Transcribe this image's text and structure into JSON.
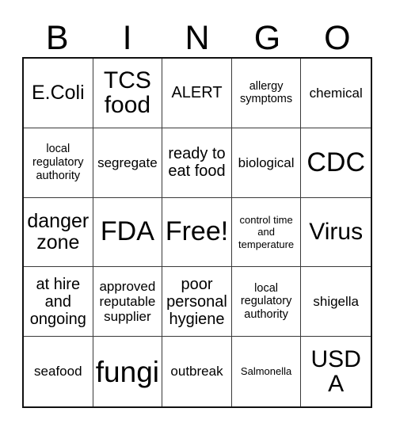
{
  "card": {
    "title": "BINGO",
    "header_letters": [
      "B",
      "I",
      "N",
      "G",
      "O"
    ],
    "free_space_label": "Free!",
    "colors": {
      "text": "#000000",
      "outer_border": "#111111",
      "inner_border": "#3a3a3a",
      "background": "#ffffff"
    },
    "rows": [
      [
        {
          "text": "E.Coli",
          "size": "fs-xl"
        },
        {
          "text": "TCS food",
          "size": "fs-2xl"
        },
        {
          "text": "ALERT",
          "size": "fs-lg"
        },
        {
          "text": "allergy symptoms",
          "size": "fs-sm"
        },
        {
          "text": "chemical",
          "size": "fs-md"
        }
      ],
      [
        {
          "text": "local regulatory authority",
          "size": "fs-sm"
        },
        {
          "text": "segregate",
          "size": "fs-md"
        },
        {
          "text": "ready to eat food",
          "size": "fs-lg"
        },
        {
          "text": "biological",
          "size": "fs-md"
        },
        {
          "text": "CDC",
          "size": "fs-3xl"
        }
      ],
      [
        {
          "text": "danger zone",
          "size": "fs-xl"
        },
        {
          "text": "FDA",
          "size": "fs-3xl"
        },
        {
          "text": "Free!",
          "size": "fs-3xl"
        },
        {
          "text": "control time and temperature",
          "size": "fs-xs"
        },
        {
          "text": "Virus",
          "size": "fs-2xl"
        }
      ],
      [
        {
          "text": "at hire and ongoing",
          "size": "fs-lg"
        },
        {
          "text": "approved reputable supplier",
          "size": "fs-md"
        },
        {
          "text": "poor personal hygiene",
          "size": "fs-lg"
        },
        {
          "text": "local regulatory authority",
          "size": "fs-sm"
        },
        {
          "text": "shigella",
          "size": "fs-md"
        }
      ],
      [
        {
          "text": "seafood",
          "size": "fs-md"
        },
        {
          "text": "fungi",
          "size": "fs-4xl"
        },
        {
          "text": "outbreak",
          "size": "fs-md"
        },
        {
          "text": "Salmonella",
          "size": "fs-xs"
        },
        {
          "text": "USDA",
          "size": "fs-2xl"
        }
      ]
    ]
  }
}
